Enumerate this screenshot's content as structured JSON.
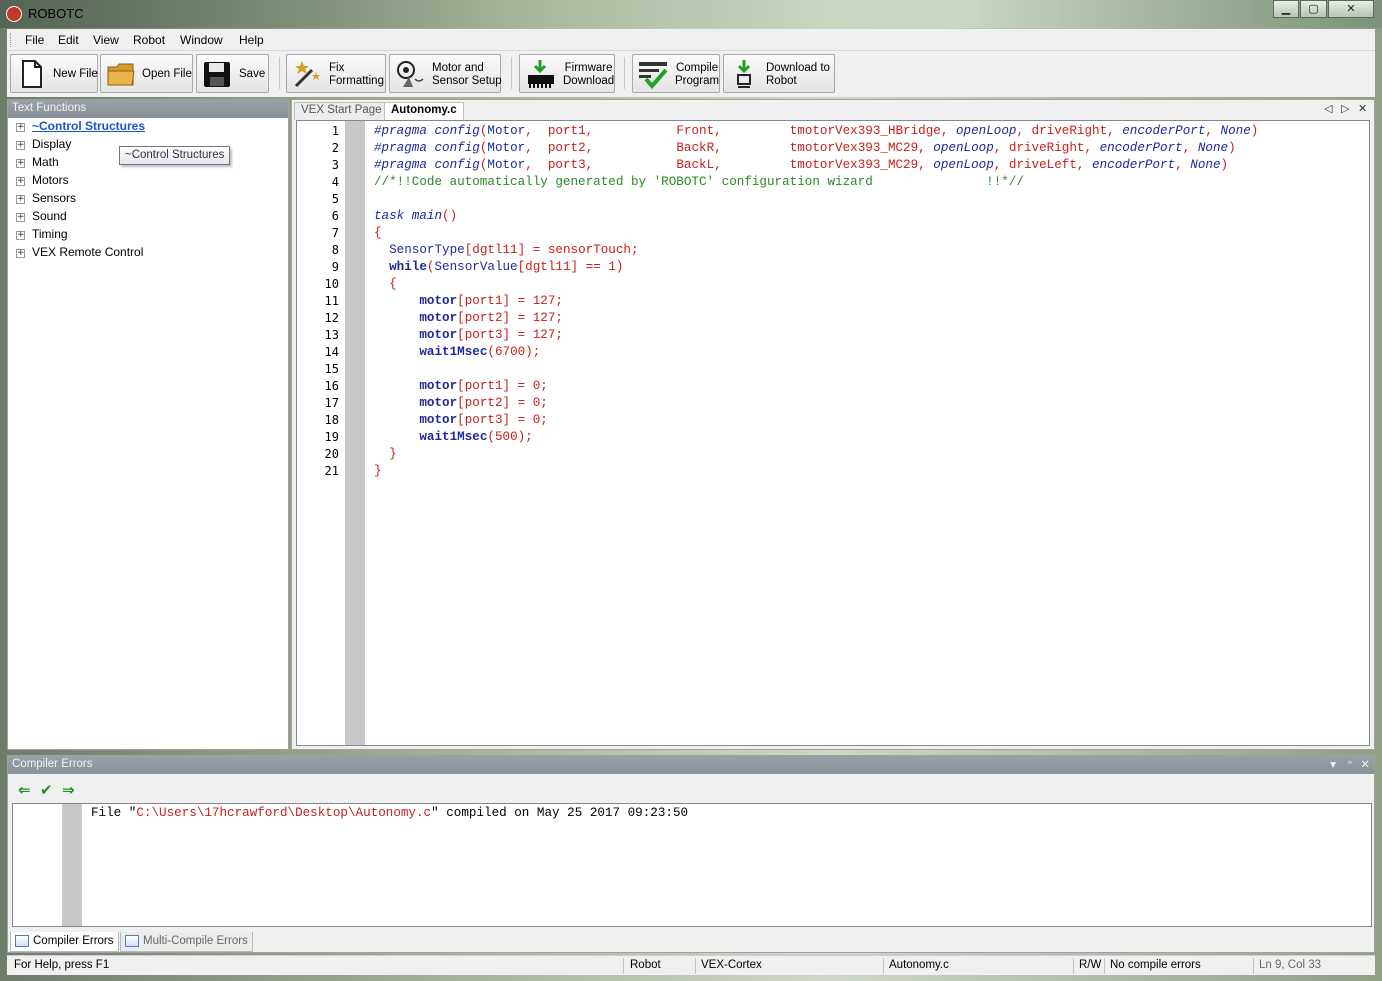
{
  "window": {
    "title": "ROBOTC",
    "minimize": "▁",
    "maximize": "▢",
    "close": "✕"
  },
  "menu": [
    "File",
    "Edit",
    "View",
    "Robot",
    "Window",
    "Help"
  ],
  "toolbar": {
    "new_file": "New File",
    "open_file": "Open File",
    "save": "Save",
    "fix_formatting": "Fix\nFormatting",
    "motor_sensor": "Motor and\nSensor Setup",
    "firmware": "Firmware\nDownload",
    "compile": "Compile\nProgram",
    "download": "Download to\nRobot"
  },
  "left_panel": {
    "title": "Text Functions",
    "items": [
      "~Control Structures",
      "Display",
      "Math",
      "Motors",
      "Sensors",
      "Sound",
      "Timing",
      "VEX Remote Control"
    ],
    "tooltip": "~Control Structures"
  },
  "editor": {
    "tabs": [
      "VEX Start Page",
      "Autonomy.c"
    ],
    "active_tab": "Autonomy.c",
    "line_numbers": [
      "1",
      "2",
      "3",
      "4",
      "5",
      "6",
      "7",
      "8",
      "9",
      "10",
      "11",
      "12",
      "13",
      "14",
      "15",
      "16",
      "17",
      "18",
      "19",
      "20",
      "21"
    ]
  },
  "compiler_panel": {
    "title": "Compiler Errors",
    "message_prefix": "File \"",
    "message_path": "C:\\Users\\17hcrawford\\Desktop\\Autonomy.c",
    "message_suffix": "\" compiled on May 25 2017 09:23:50",
    "tabs": [
      "Compiler Errors",
      "Multi-Compile Errors"
    ]
  },
  "status_bar": {
    "help": "For Help, press F1",
    "robot": "Robot",
    "platform": "VEX-Cortex",
    "file": "Autonomy.c",
    "mode": "R/W",
    "errors": "No compile errors",
    "position": "Ln 9, Col 33"
  },
  "colors": {
    "keyword": "#1c2a9c",
    "string": "#c8201c",
    "comment": "#2a8a24",
    "panel_header": "#8a9098"
  }
}
